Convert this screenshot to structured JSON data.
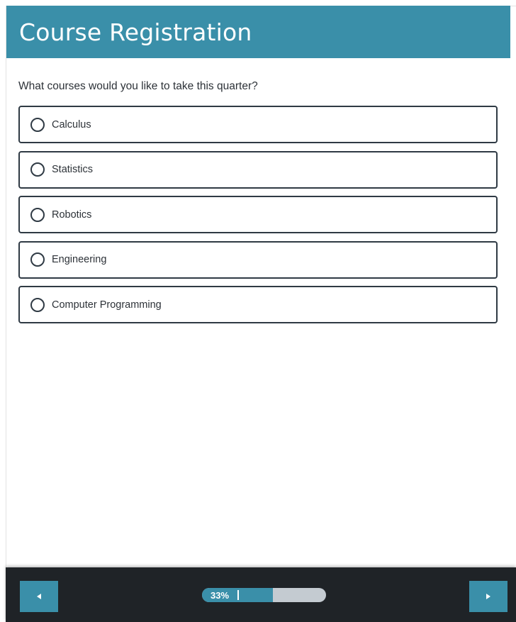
{
  "survey": {
    "title": "Course Registration",
    "question": "What courses would you like to take this quarter?",
    "options": [
      {
        "label": "Calculus",
        "selected": false
      },
      {
        "label": "Statistics",
        "selected": false
      },
      {
        "label": "Robotics",
        "selected": false
      },
      {
        "label": "Engineering",
        "selected": false
      },
      {
        "label": "Computer Programming",
        "selected": false
      }
    ]
  },
  "footer": {
    "progress_label": "33%",
    "progress_value": 0.33,
    "prev_icon": "triangle-left-icon",
    "next_icon": "triangle-right-icon"
  },
  "colors": {
    "accent": "#3a8fa9",
    "footer_bg": "#1f2327",
    "border": "#2f3a44",
    "progress_track": "#c4cbd1"
  }
}
